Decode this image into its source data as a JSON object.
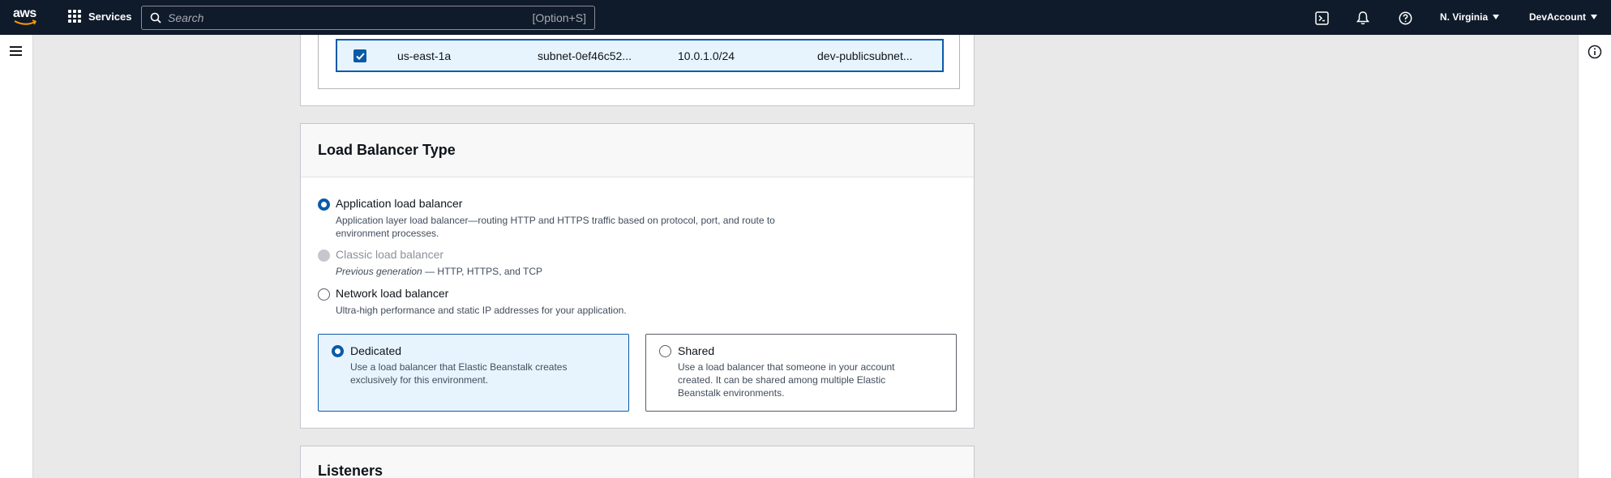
{
  "nav": {
    "logo_text": "aws",
    "services_label": "Services",
    "search_placeholder": "Search",
    "search_shortcut": "[Option+S]",
    "region": "N. Virginia",
    "account": "DevAccount"
  },
  "subnet_row": {
    "selected": true,
    "az": "us-east-1a",
    "subnet_id": "subnet-0ef46c52...",
    "cidr": "10.0.1.0/24",
    "name": "dev-publicsubnet..."
  },
  "load_balancer_type": {
    "title": "Load Balancer Type",
    "options": [
      {
        "label": "Application load balancer",
        "desc": "Application layer load balancer—routing HTTP and HTTPS traffic based on protocol, port, and route to environment processes.",
        "state": "selected"
      },
      {
        "label": "Classic load balancer",
        "desc_italic": "Previous generation",
        "desc": " — HTTP, HTTPS, and TCP",
        "state": "disabled"
      },
      {
        "label": "Network load balancer",
        "desc": "Ultra-high performance and static IP addresses for your application.",
        "state": "unselected"
      }
    ],
    "tiles": [
      {
        "label": "Dedicated",
        "desc": "Use a load balancer that Elastic Beanstalk creates exclusively for this environment.",
        "state": "selected"
      },
      {
        "label": "Shared",
        "desc": "Use a load balancer that someone in your account created. It can be shared among multiple Elastic Beanstalk environments.",
        "state": "unselected"
      }
    ]
  },
  "listeners": {
    "title": "Listeners"
  },
  "colors": {
    "nav_bg": "#0f1b2a",
    "accent": "#0a5aa9",
    "selected_bg": "#e8f4fd"
  }
}
